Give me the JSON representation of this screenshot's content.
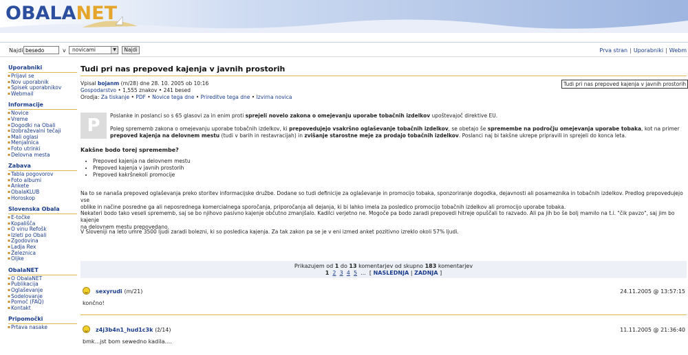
{
  "header": {
    "logo_main": "OBALA",
    "logo_accent": "NET"
  },
  "toolbar": {
    "search_label": "Najdi",
    "search_value": "besedo",
    "in_label": "v",
    "scope_value": "novicami",
    "search_button": "Najdi",
    "links": [
      "Prva stran",
      "Uporabniki",
      "Webm"
    ]
  },
  "sidebar": [
    {
      "title": "Uporabniki",
      "items": [
        "Prijavi se",
        "Nov uporabnik",
        "Spisek uporabnikov",
        "Webmail"
      ]
    },
    {
      "title": "Informacije",
      "items": [
        "Novice",
        "Vreme",
        "Dogodki na Obali",
        "Izobraževalni tečaji",
        "Mali oglasi",
        "Menjalnica",
        "Foto utrinki",
        "Delovna mesta"
      ]
    },
    {
      "title": "Zabava",
      "items": [
        "Tabla pogovorov",
        "Foto albumi",
        "Ankete",
        "ObalaKLUB",
        "Horoskop"
      ]
    },
    {
      "title": "Slovenska Obala",
      "items": [
        "E-točke",
        "Kopališča",
        "O vinu Refošk",
        "Izleti po Obali",
        "Zgodovina",
        "Ladja Rex",
        "Železnica",
        "Oljke"
      ]
    },
    {
      "title": "ObalaNET",
      "items": [
        "O ObalaNET",
        "Publikacija",
        "Oglaševanje",
        "Sodelovanje",
        "Pomoč (FAQ)",
        "Kontakt"
      ]
    },
    {
      "title": "Pripomočki",
      "items": [
        "Prtava nasake"
      ]
    }
  ],
  "article": {
    "title": "Tudi pri nas prepoved kajenja v javnih prostorih",
    "meta": {
      "posted_prefix": "Vpisal",
      "author": "bojanm",
      "author_suffix": "(m/28) dne 28. 10. 2005 ob 10:16",
      "category": "Gospodarstvo",
      "stats": "• 1,555 znakov • 241 besed",
      "tools_label": "Orodja:",
      "tools": [
        "Za tiskanje",
        "PDF",
        "Novice tega dne",
        "Prireditve tega dne",
        "Izvirna novica"
      ]
    },
    "title_box": "Tudi pri nas prepoved kajenja v javnih prostorih",
    "drop_icon": "P",
    "p1_a": "Poslanke in poslanci so s 65 glasovi za in enim proti ",
    "p1_b": "sprejeli novelo zakona o omejevanju uporabe tobačnih izdelkov",
    "p1_c": " upoštevajoč direktive EU.",
    "p2_a": "Poleg sprememb zakona o omejevanju uporabe tobačnih izdelkov, ki ",
    "p2_b": "prepovedujejo vsakršno oglaševanje tobačnih izdelkov",
    "p2_c": ", se obetajo še ",
    "p2_d": "spremembe na področju omejevanja uporabe tobaka",
    "p2_e": ", kot na primer",
    "p2_f": "prepoved kajenja na delovnem mestu",
    "p2_g": " (tudi v barih in restavracijah) in ",
    "p2_h": "zvišanje starostne meje za prodajo tobačnih izdelkov",
    "p2_i": ". Poslanci naj bi takšne ukrepe pripravili in sprejeli do konca leta.",
    "subheading": "Kakšne bodo torej spremembe?",
    "bullets": [
      "Prepoved kajenja na delovnem mestu",
      "Prepoved kajenja v javnih prostorih",
      "Prepoved kakršnekoli promocije"
    ],
    "p3_l1": "Na to se nanaša prepoved oglaševanja preko storitev informacijske družbe. Dodane so tudi definicije za oglaševanje in promocijo tobaka, sponzoriranje dogodka, dejavnosti ali posameznika in tobačnih izdelkov. Predlog prepovedujejo vse",
    "p3_l2": "oblike in načine posredne ga ali neposrednega komercialnega sporočanja, priporočanja ali dejanja, ki bi lahko imela za posledico promocijo tobačnih izdelkov ali promocijo uporabe tobaka.",
    "p4_l1": "Nekateri bodo tako veseli sprememb, saj se bo njihovo pasivno kajenje občutno zmanjšalo. Kadilci verjetno ne. Mogoče pa bodo zaradi prepovedi  hitreje opuščali to razvado. Ali pa jih bo še bolj mamilo na t.i. \"čik pavzo\", saj  jim bo kajenje",
    "p4_l2": "na delovnem mestu prepovedano.",
    "p5": "V Sloveniji na leto umre 3500 ljudi zaradi bolezni, ki so posledica kajenja. Za tak zakon pa se je v eni izmed anket pozitivno izreklo okoli 57% ljudi."
  },
  "pager": {
    "line1_a": "Prikazujem od ",
    "from": "1",
    "line1_b": " do ",
    "to": "13",
    "line1_c": " komentarjev od skupno ",
    "total": "183",
    "line1_d": " komentarjev",
    "current_page": "1",
    "pages": [
      "2",
      "3",
      "4",
      "5"
    ],
    "ellipsis": "...",
    "next_label": "NASLEDNJA",
    "last_label": "ZADNJA"
  },
  "comments": [
    {
      "author": "sexyrudi",
      "info": "(m/21)",
      "date": "24.11.2005 @ 13:57:15",
      "text": "končno!"
    },
    {
      "author": "z4j3b4n1_hud1c3k",
      "info": "(ž/14)",
      "date": "11.11.2005 @ 21:36:40",
      "text": "bmk...jst bom sewedno kadila...."
    }
  ],
  "colors": {
    "link": "#1a3c8c",
    "accent_line": "#e0b84a",
    "pager_bg": "#edf0f7"
  }
}
